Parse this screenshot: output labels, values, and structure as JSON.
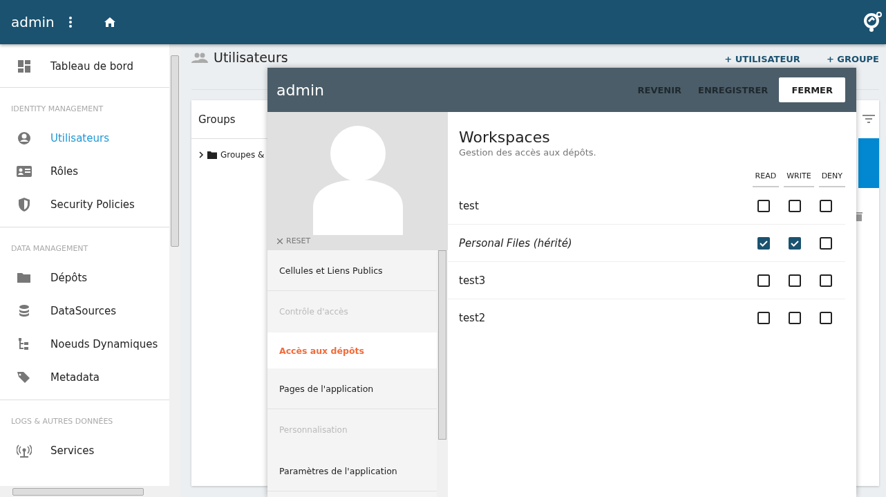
{
  "app_bar": {
    "title": "admin"
  },
  "sidebar": {
    "sections": [
      {
        "items": [
          {
            "label": "Tableau de bord",
            "selected": false
          }
        ]
      },
      {
        "title": "IDENTITY MANAGEMENT",
        "items": [
          {
            "label": "Utilisateurs",
            "selected": true
          },
          {
            "label": "Rôles",
            "selected": false
          },
          {
            "label": "Security Policies",
            "selected": false
          }
        ]
      },
      {
        "title": "DATA MANAGEMENT",
        "items": [
          {
            "label": "Dépôts",
            "selected": false
          },
          {
            "label": "DataSources",
            "selected": false
          },
          {
            "label": "Noeuds Dynamiques",
            "selected": false
          },
          {
            "label": "Metadata",
            "selected": false
          }
        ]
      },
      {
        "title": "LOGS & AUTRES DONNÉES",
        "items": [
          {
            "label": "Services",
            "selected": false
          }
        ]
      }
    ]
  },
  "page": {
    "title": "Utilisateurs",
    "actions": [
      "+ UTILISATEUR",
      "+ GROUPE"
    ],
    "groups_panel": {
      "title": "Groups",
      "tree": [
        {
          "label": "Groupes &",
          "expanded": false
        }
      ]
    }
  },
  "editor": {
    "title": "admin",
    "actions": [
      "REVENIR",
      "ENREGISTRER"
    ],
    "close": "FERMER",
    "reset": "RESET",
    "menu": [
      {
        "kind": "item",
        "label": "Cellules et Liens Publics",
        "selected": false
      },
      {
        "kind": "header",
        "label": "Contrôle d'accès"
      },
      {
        "kind": "item",
        "label": "Accès aux dépôts",
        "selected": true
      },
      {
        "kind": "item",
        "label": "Pages de l'application",
        "selected": false
      },
      {
        "kind": "header",
        "label": "Personnalisation"
      },
      {
        "kind": "item",
        "label": "Paramètres de l'application",
        "selected": false
      }
    ],
    "section": {
      "title": "Workspaces",
      "subtitle": "Gestion des accès aux dépôts.",
      "columns": [
        "READ",
        "WRITE",
        "DENY"
      ],
      "rows": [
        {
          "name": "test",
          "inherited": false,
          "checks": [
            false,
            false,
            false
          ]
        },
        {
          "name": "Personal Files (hérité)",
          "inherited": true,
          "checks": [
            true,
            true,
            false
          ]
        },
        {
          "name": "test3",
          "inherited": false,
          "checks": [
            false,
            false,
            false
          ]
        },
        {
          "name": "test2",
          "inherited": false,
          "checks": [
            false,
            false,
            false
          ]
        }
      ]
    }
  }
}
